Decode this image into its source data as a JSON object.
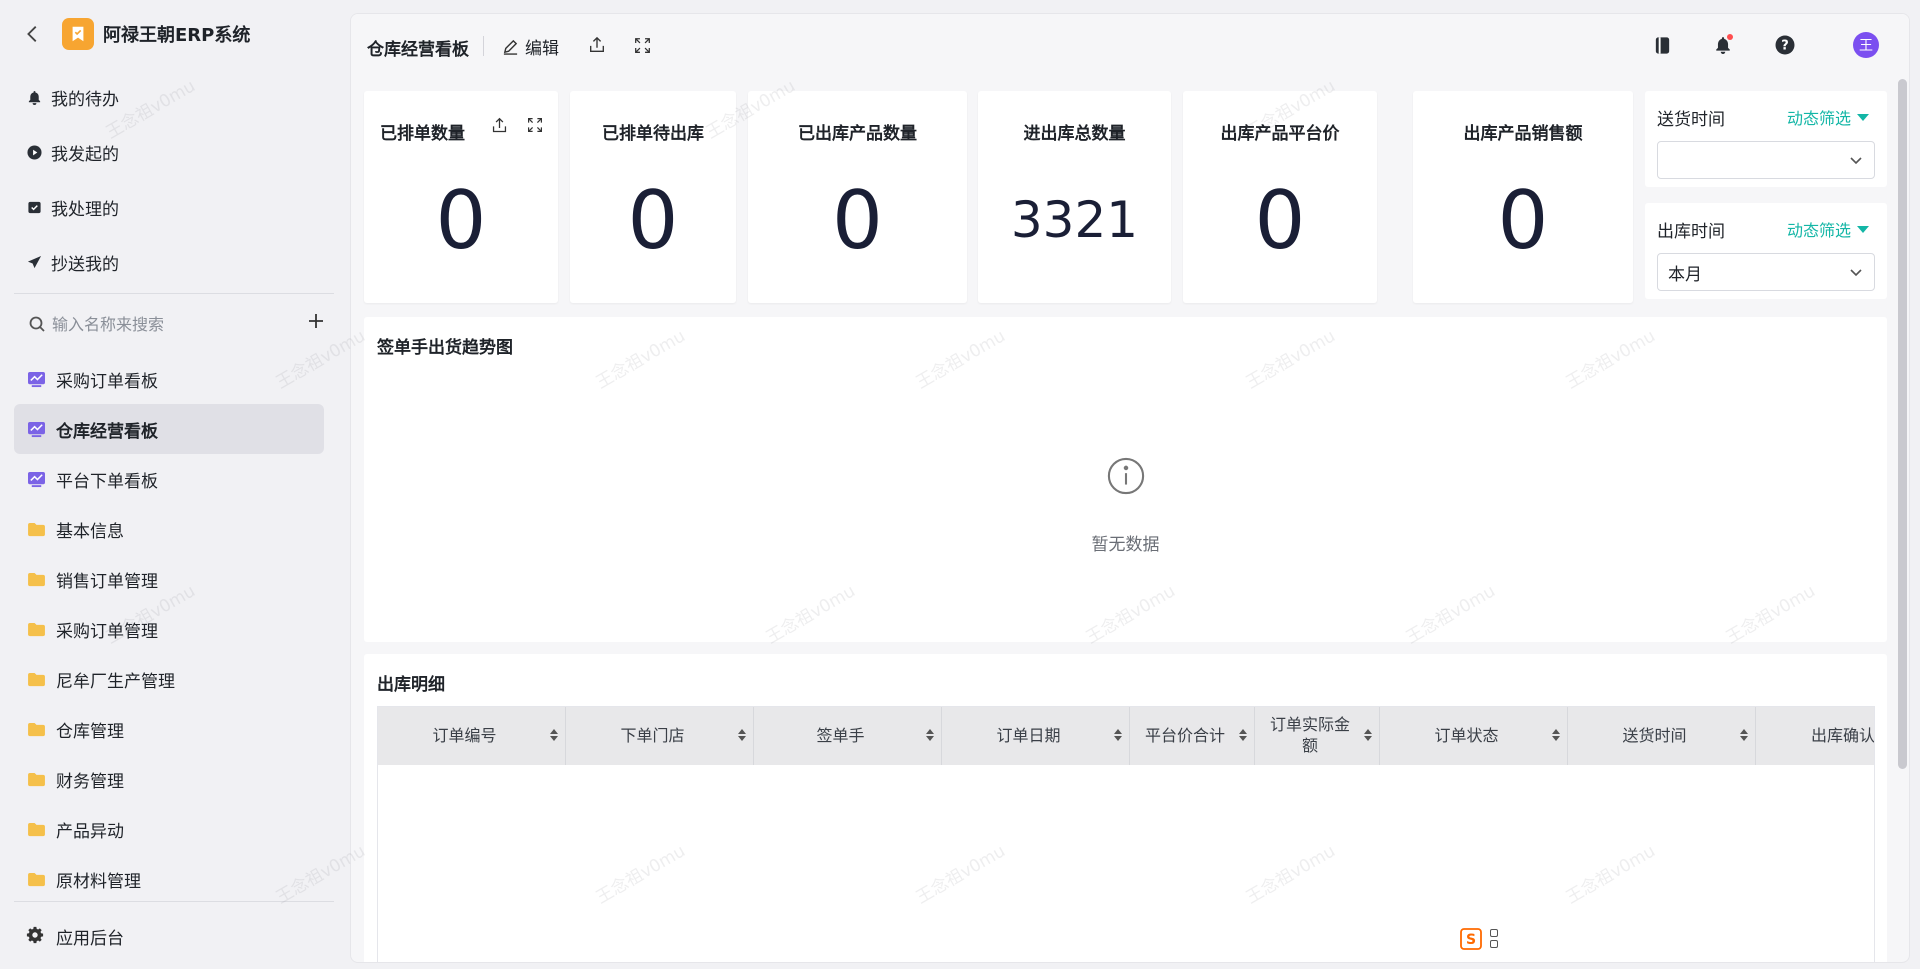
{
  "app": {
    "title": "阿禄王朝ERP系统",
    "back_icon": "chevron-left-icon"
  },
  "quick_nav": [
    {
      "label": "我的待办",
      "icon": "bell-icon"
    },
    {
      "label": "我发起的",
      "icon": "play-circle-icon"
    },
    {
      "label": "我处理的",
      "icon": "inbox-check-icon"
    },
    {
      "label": "抄送我的",
      "icon": "send-icon"
    }
  ],
  "search": {
    "placeholder": "输入名称来搜索"
  },
  "nav": [
    {
      "label": "采购订单看板",
      "icon": "dashboard-icon",
      "active": false
    },
    {
      "label": "仓库经营看板",
      "icon": "dashboard-icon",
      "active": true
    },
    {
      "label": "平台下单看板",
      "icon": "dashboard-icon",
      "active": false
    },
    {
      "label": "基本信息",
      "icon": "folder-icon",
      "active": false
    },
    {
      "label": "销售订单管理",
      "icon": "folder-icon",
      "active": false
    },
    {
      "label": "采购订单管理",
      "icon": "folder-icon",
      "active": false
    },
    {
      "label": "尼牟厂生产管理",
      "icon": "folder-icon",
      "active": false
    },
    {
      "label": "仓库管理",
      "icon": "folder-icon",
      "active": false
    },
    {
      "label": "财务管理",
      "icon": "folder-icon",
      "active": false
    },
    {
      "label": "产品异动",
      "icon": "folder-icon",
      "active": false
    },
    {
      "label": "原材料管理",
      "icon": "folder-icon",
      "active": false
    }
  ],
  "settings": {
    "label": "应用后台"
  },
  "topbar": {
    "title": "仓库经营看板",
    "edit_label": "编辑",
    "avatar_text": "王"
  },
  "stats": [
    {
      "title": "已排单数量",
      "value": "0"
    },
    {
      "title": "已排单待出库",
      "value": "0"
    },
    {
      "title": "已出库产品数量",
      "value": "0"
    },
    {
      "title": "进出库总数量",
      "value": "3321"
    },
    {
      "title": "出库产品平台价",
      "value": "0"
    },
    {
      "title": "出库产品销售额",
      "value": "0"
    }
  ],
  "filters": [
    {
      "label": "送货时间",
      "dynamic": "动态筛选",
      "value": ""
    },
    {
      "label": "出库时间",
      "dynamic": "动态筛选",
      "value": "本月"
    }
  ],
  "chart_panel": {
    "title": "签单手出货趋势图",
    "empty_text": "暂无数据"
  },
  "table_panel": {
    "title": "出库明细",
    "columns": [
      "订单编号",
      "下单门店",
      "签单手",
      "订单日期",
      "平台价合计",
      "订单实际金额",
      "订单状态",
      "送货时间",
      "出库确认"
    ]
  },
  "watermark": "王念祖v0mu",
  "colors": {
    "accent": "#13b6a6",
    "avatar": "#7b4ff0",
    "logo": "#f7a531",
    "dashboard_icon": "#7b63e6",
    "folder_icon": "#f5c04a"
  }
}
